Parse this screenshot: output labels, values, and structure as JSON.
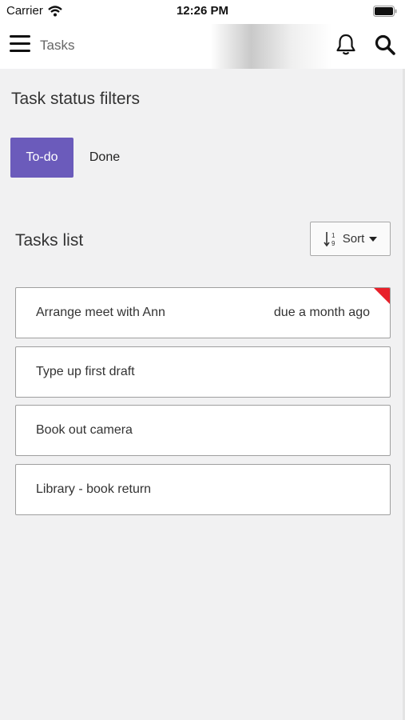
{
  "status_bar": {
    "carrier": "Carrier",
    "time": "12:26 PM"
  },
  "header": {
    "title": "Tasks",
    "icons": [
      "menu-icon",
      "bell-icon",
      "search-icon"
    ]
  },
  "filters": {
    "heading": "Task status filters",
    "todo_label": "To-do",
    "done_label": "Done",
    "active": "To-do",
    "active_color": "#6b5bbb"
  },
  "tasks": {
    "heading": "Tasks list",
    "sort_label": "Sort",
    "items": [
      {
        "title": "Arrange meet with Ann",
        "due": "due a month ago",
        "overdue": true
      },
      {
        "title": "Type up first draft",
        "due": ""
      },
      {
        "title": "Book out camera",
        "due": ""
      },
      {
        "title": "Library - book return",
        "due": ""
      }
    ],
    "overdue_color": "#e8202a"
  }
}
